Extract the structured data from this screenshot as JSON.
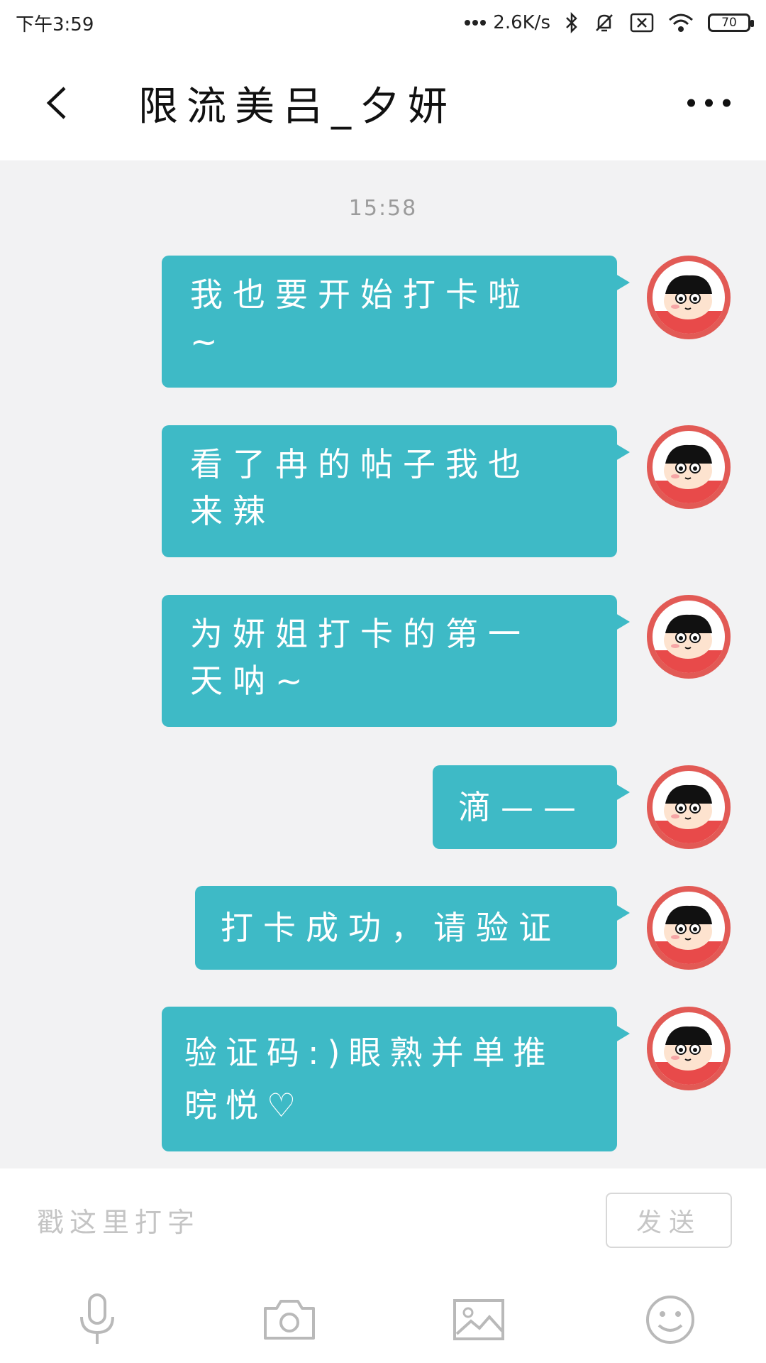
{
  "status_bar": {
    "time": "下午3:59",
    "network_speed": "2.6K/s",
    "battery": "70",
    "icons": [
      "signal-dots-icon",
      "bluetooth-icon",
      "mute-bell-icon",
      "sim-x-icon",
      "wifi-icon",
      "battery-icon"
    ]
  },
  "header": {
    "title": "限流美吕_夕妍",
    "back_icon": "chevron-left-icon",
    "more_icon": "more-dots-icon"
  },
  "chat": {
    "timestamp": "15:58",
    "messages": [
      {
        "line1": "我也要开始打卡啦",
        "line2": "~"
      },
      {
        "line1": "看了冉的帖子我也",
        "line2": "来辣"
      },
      {
        "line1": "为妍姐打卡的第一",
        "line2": "天呐~"
      },
      {
        "line1": "滴——"
      },
      {
        "line1": "打卡成功，请验证"
      },
      {
        "line1": "验证码:)眼熟并单推",
        "line2": "晥悦♡"
      }
    ]
  },
  "composer": {
    "placeholder": "戳这里打字",
    "send_label": "发送"
  },
  "toolbar": {
    "items": [
      "microphone-icon",
      "camera-icon",
      "image-icon",
      "emoji-icon"
    ]
  },
  "colors": {
    "bubble": "#3ebac6",
    "avatar_ring": "#e25a55",
    "background": "#f2f2f3"
  }
}
